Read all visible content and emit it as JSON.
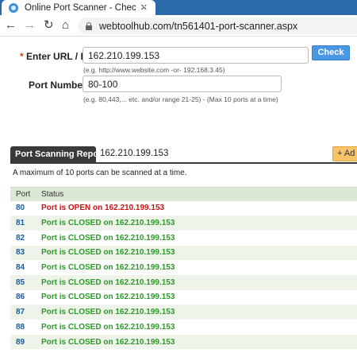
{
  "browser": {
    "tab_title": "Online Port Scanner - Check Ope",
    "tab_close": "×",
    "new_tab": "+",
    "back": "←",
    "forward": "→",
    "reload": "↻",
    "home": "⌂",
    "url": "webtoolhub.com/tn561401-port-scanner.aspx"
  },
  "form": {
    "required_marker": "*",
    "url_label": "Enter URL / IP",
    "url_value": "162.210.199.153",
    "url_hint": "(e.g. http://www.website.com -or- 192.168.3.45)",
    "ports_label": "Port Number(s)",
    "ports_value": "80-100",
    "ports_hint": "(e.g. 80,443,... etc. and/or range 21-25) - (Max 10 ports at a time)",
    "check_button": "Check"
  },
  "report": {
    "tab_label": "Port Scanning Report:",
    "target": "162.210.199.153",
    "add_button": "+ Ad",
    "max_note": "A maximum of 10 ports can be scanned at a time.",
    "columns": [
      "Port",
      "Status"
    ],
    "rows": [
      {
        "port": "80",
        "status": "Port is OPEN on 162.210.199.153",
        "state": "open"
      },
      {
        "port": "81",
        "status": "Port is CLOSED on 162.210.199.153",
        "state": "closed"
      },
      {
        "port": "82",
        "status": "Port is CLOSED on 162.210.199.153",
        "state": "closed"
      },
      {
        "port": "83",
        "status": "Port is CLOSED on 162.210.199.153",
        "state": "closed"
      },
      {
        "port": "84",
        "status": "Port is CLOSED on 162.210.199.153",
        "state": "closed"
      },
      {
        "port": "85",
        "status": "Port is CLOSED on 162.210.199.153",
        "state": "closed"
      },
      {
        "port": "86",
        "status": "Port is CLOSED on 162.210.199.153",
        "state": "closed"
      },
      {
        "port": "87",
        "status": "Port is CLOSED on 162.210.199.153",
        "state": "closed"
      },
      {
        "port": "88",
        "status": "Port is CLOSED on 162.210.199.153",
        "state": "closed"
      },
      {
        "port": "89",
        "status": "Port is CLOSED on 162.210.199.153",
        "state": "closed"
      }
    ]
  },
  "colors": {
    "tab_strip": "#2a6aa8",
    "check_button": "#4a97e4",
    "status_open": "#cc1111",
    "status_closed": "#2c9a28",
    "port_number": "#1a5a9a",
    "table_header": "#dbe8d4",
    "add_button": "#f7c46a"
  },
  "icons": {
    "favicon": "globe-favicon-icon",
    "lock": "lock-icon"
  }
}
